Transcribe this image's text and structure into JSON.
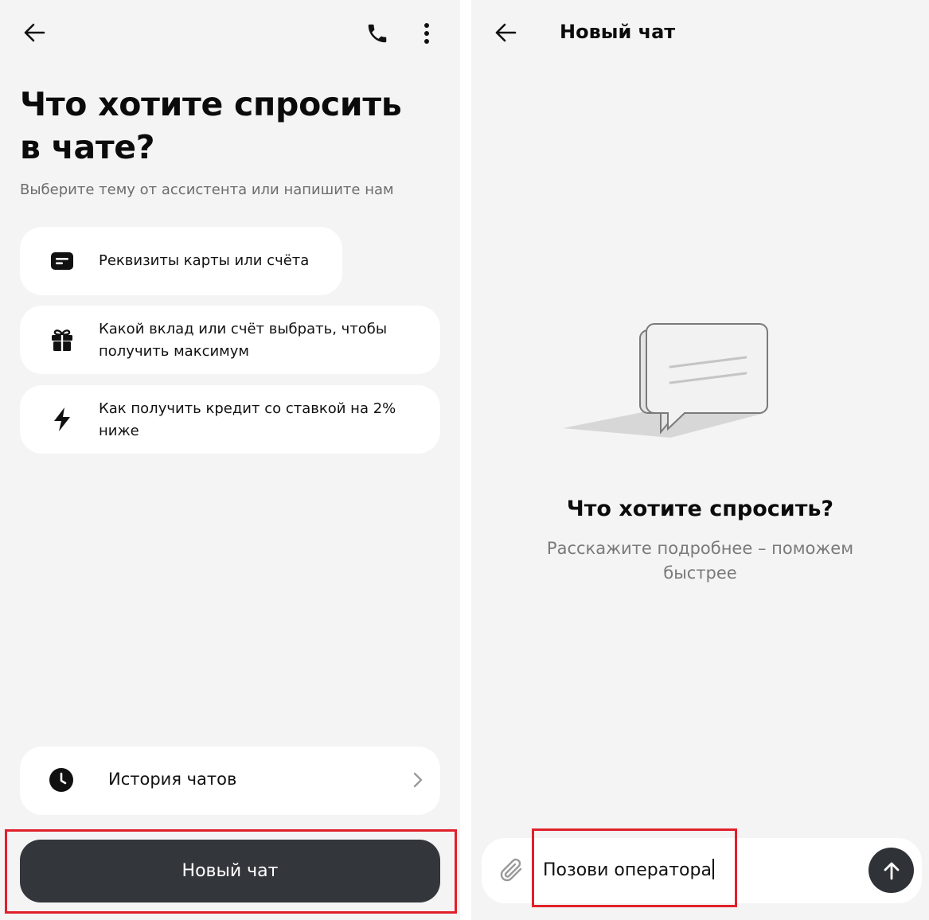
{
  "left": {
    "heading": "Что хотите спросить\nв чате?",
    "subheading": "Выберите тему от ассистента или напишите нам",
    "topics": [
      {
        "icon": "card-icon",
        "label": "Реквизиты карты или счёта"
      },
      {
        "icon": "gift-icon",
        "label": "Какой вклад или счёт выбрать, чтобы получить максимум"
      },
      {
        "icon": "lightning-icon",
        "label": "Как получить кредит со ставкой на 2% ниже"
      }
    ],
    "history": {
      "icon": "clock-icon",
      "label": "История чатов"
    },
    "new_chat_button": "Новый чат"
  },
  "right": {
    "title": "Новый чат",
    "empty_title": "Что хотите спросить?",
    "empty_subtitle": "Расскажите подробнее – поможем быстрее",
    "input_value": "Позови оператора"
  },
  "colors": {
    "panel_bg": "#f4f4f4",
    "card_bg": "#ffffff",
    "primary_button": "#33363b",
    "highlight_border": "#e0202a"
  }
}
